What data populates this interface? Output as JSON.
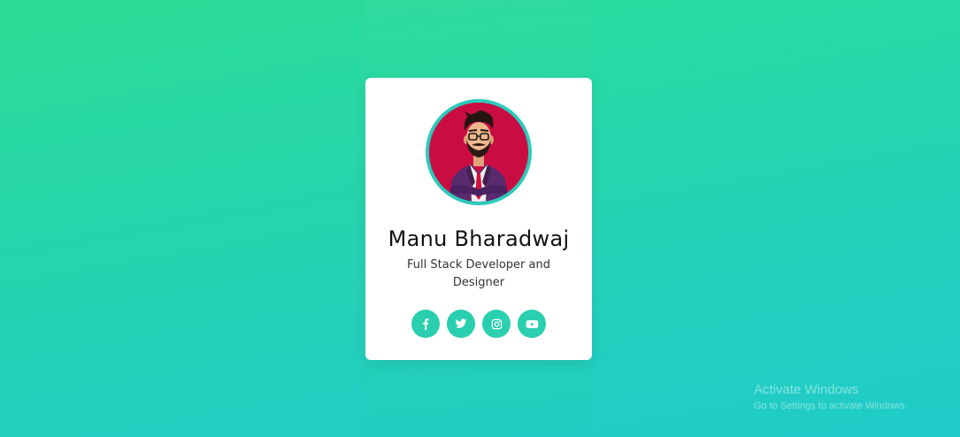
{
  "profile": {
    "name": "Manu Bharadwaj",
    "role": "Full Stack Developer and Designer"
  },
  "social": [
    {
      "icon": "facebook-icon"
    },
    {
      "icon": "twitter-icon"
    },
    {
      "icon": "instagram-icon"
    },
    {
      "icon": "youtube-icon"
    }
  ],
  "watermark": {
    "title": "Activate Windows",
    "subtitle": "Go to Settings to activate Windows."
  },
  "colors": {
    "accent": "#29cfae",
    "avatar_bg": "#c90d43",
    "background_top": "#2bdf96",
    "background_bottom": "#20cbc9"
  }
}
